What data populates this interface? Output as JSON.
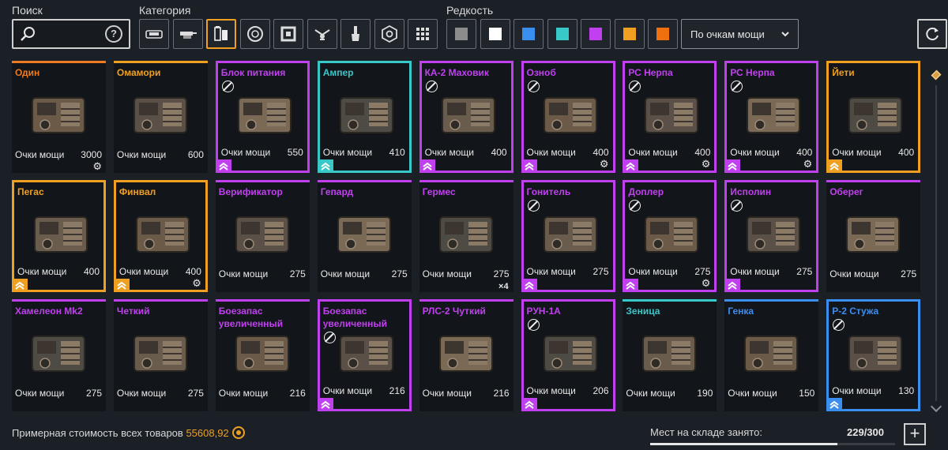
{
  "filters": {
    "search_label": "Поиск",
    "search_placeholder": "",
    "help_label": "?",
    "category_label": "Категория",
    "rarity_label": "Редкость",
    "categories": [
      {
        "icon": "cabin-icon",
        "active": false
      },
      {
        "icon": "weapon-icon",
        "active": false
      },
      {
        "icon": "generator-icon",
        "active": true
      },
      {
        "icon": "wheel-icon",
        "active": false
      },
      {
        "icon": "frame-icon",
        "active": false
      },
      {
        "icon": "drone-icon",
        "active": false
      },
      {
        "icon": "paint-brush-icon",
        "active": false
      },
      {
        "icon": "gear-module-icon",
        "active": false
      },
      {
        "icon": "grid-all-icon",
        "active": false
      }
    ],
    "rarities": [
      {
        "name": "common",
        "color": "#8c8c8c"
      },
      {
        "name": "uncommon",
        "color": "#ffffff"
      },
      {
        "name": "rare",
        "color": "#3a8ef0"
      },
      {
        "name": "special",
        "color": "#38c8c8"
      },
      {
        "name": "epic",
        "color": "#c040f0"
      },
      {
        "name": "legendary",
        "color": "#f0a020"
      },
      {
        "name": "relic",
        "color": "#f07010"
      }
    ],
    "sort_label": "По очкам мощи"
  },
  "colors": {
    "relic": "#f07a20",
    "legendary": "#f0a020",
    "epic": "#c040f0",
    "special": "#38c8c8",
    "rare": "#3a8ef0"
  },
  "items": [
    {
      "name": "Один",
      "rarity": "relic",
      "power_label": "Очки мощи",
      "power": "3000",
      "framed": false,
      "no_icon": false,
      "gear": true,
      "rank": false,
      "count": ""
    },
    {
      "name": "Омамори",
      "rarity": "legendary",
      "power_label": "Очки мощи",
      "power": "600",
      "framed": false,
      "no_icon": false,
      "gear": false,
      "rank": false,
      "count": ""
    },
    {
      "name": "Блок питания",
      "rarity": "epic",
      "power_label": "Очки мощи",
      "power": "550",
      "framed": true,
      "no_icon": true,
      "gear": false,
      "rank": true,
      "count": ""
    },
    {
      "name": "Ампер",
      "rarity": "special",
      "power_label": "Очки мощи",
      "power": "410",
      "framed": true,
      "no_icon": false,
      "gear": false,
      "rank": true,
      "count": ""
    },
    {
      "name": "КА-2 Маховик",
      "rarity": "epic",
      "power_label": "Очки мощи",
      "power": "400",
      "framed": true,
      "no_icon": true,
      "gear": false,
      "rank": true,
      "count": ""
    },
    {
      "name": "Озноб",
      "rarity": "epic",
      "power_label": "Очки мощи",
      "power": "400",
      "framed": true,
      "no_icon": true,
      "gear": true,
      "rank": true,
      "count": ""
    },
    {
      "name": "РС Нерпа",
      "rarity": "epic",
      "power_label": "Очки мощи",
      "power": "400",
      "framed": true,
      "no_icon": true,
      "gear": true,
      "rank": true,
      "count": ""
    },
    {
      "name": "РС Нерпа",
      "rarity": "epic",
      "power_label": "Очки мощи",
      "power": "400",
      "framed": true,
      "no_icon": true,
      "gear": true,
      "rank": true,
      "count": ""
    },
    {
      "name": "Йети",
      "rarity": "legendary",
      "power_label": "Очки мощи",
      "power": "400",
      "framed": true,
      "no_icon": false,
      "gear": false,
      "rank": true,
      "count": ""
    },
    {
      "name": "Пегас",
      "rarity": "legendary",
      "power_label": "Очки мощи",
      "power": "400",
      "framed": true,
      "no_icon": false,
      "gear": false,
      "rank": true,
      "count": ""
    },
    {
      "name": "Финвал",
      "rarity": "legendary",
      "power_label": "Очки мощи",
      "power": "400",
      "framed": true,
      "no_icon": false,
      "gear": true,
      "rank": true,
      "count": ""
    },
    {
      "name": "Верификатор",
      "rarity": "epic",
      "power_label": "Очки мощи",
      "power": "275",
      "framed": false,
      "no_icon": false,
      "gear": false,
      "rank": false,
      "count": ""
    },
    {
      "name": "Гепард",
      "rarity": "epic",
      "power_label": "Очки мощи",
      "power": "275",
      "framed": false,
      "no_icon": false,
      "gear": false,
      "rank": false,
      "count": ""
    },
    {
      "name": "Гермес",
      "rarity": "epic",
      "power_label": "Очки мощи",
      "power": "275",
      "framed": false,
      "no_icon": false,
      "gear": false,
      "rank": false,
      "count": "×4"
    },
    {
      "name": "Гонитель",
      "rarity": "epic",
      "power_label": "Очки мощи",
      "power": "275",
      "framed": true,
      "no_icon": true,
      "gear": false,
      "rank": true,
      "count": ""
    },
    {
      "name": "Доплер",
      "rarity": "epic",
      "power_label": "Очки мощи",
      "power": "275",
      "framed": true,
      "no_icon": true,
      "gear": true,
      "rank": true,
      "count": ""
    },
    {
      "name": "Исполин",
      "rarity": "epic",
      "power_label": "Очки мощи",
      "power": "275",
      "framed": true,
      "no_icon": true,
      "gear": false,
      "rank": true,
      "count": ""
    },
    {
      "name": "Оберег",
      "rarity": "epic",
      "power_label": "Очки мощи",
      "power": "275",
      "framed": false,
      "no_icon": false,
      "gear": false,
      "rank": false,
      "count": ""
    },
    {
      "name": "Хамелеон Mk2",
      "rarity": "epic",
      "power_label": "Очки мощи",
      "power": "275",
      "framed": false,
      "no_icon": false,
      "gear": false,
      "rank": false,
      "count": ""
    },
    {
      "name": "Четкий",
      "rarity": "epic",
      "power_label": "Очки мощи",
      "power": "275",
      "framed": false,
      "no_icon": false,
      "gear": false,
      "rank": false,
      "count": ""
    },
    {
      "name": "Боезапас увеличенный",
      "rarity": "epic",
      "power_label": "Очки мощи",
      "power": "216",
      "framed": false,
      "no_icon": false,
      "gear": false,
      "rank": false,
      "count": ""
    },
    {
      "name": "Боезапас увеличенный",
      "rarity": "epic",
      "power_label": "Очки мощи",
      "power": "216",
      "framed": true,
      "no_icon": true,
      "gear": false,
      "rank": true,
      "count": ""
    },
    {
      "name": "РЛС-2 Чуткий",
      "rarity": "epic",
      "power_label": "Очки мощи",
      "power": "216",
      "framed": false,
      "no_icon": false,
      "gear": false,
      "rank": false,
      "count": ""
    },
    {
      "name": "РУН-1А",
      "rarity": "epic",
      "power_label": "Очки мощи",
      "power": "206",
      "framed": true,
      "no_icon": true,
      "gear": false,
      "rank": true,
      "count": ""
    },
    {
      "name": "Зеница",
      "rarity": "special",
      "power_label": "Очки мощи",
      "power": "190",
      "framed": false,
      "no_icon": false,
      "gear": false,
      "rank": false,
      "count": ""
    },
    {
      "name": "Генка",
      "rarity": "rare",
      "power_label": "Очки мощи",
      "power": "150",
      "framed": false,
      "no_icon": false,
      "gear": false,
      "rank": false,
      "count": ""
    },
    {
      "name": "Р-2 Стужа",
      "rarity": "rare",
      "power_label": "Очки мощи",
      "power": "130",
      "framed": true,
      "no_icon": true,
      "gear": false,
      "rank": true,
      "count": ""
    }
  ],
  "footer": {
    "cost_label": "Примерная стоимость всех товаров",
    "cost_value": "55608,92",
    "storage_label": "Мест на складе занято:",
    "storage_value": "229/300",
    "storage_fraction": 0.763,
    "add_label": "+"
  }
}
